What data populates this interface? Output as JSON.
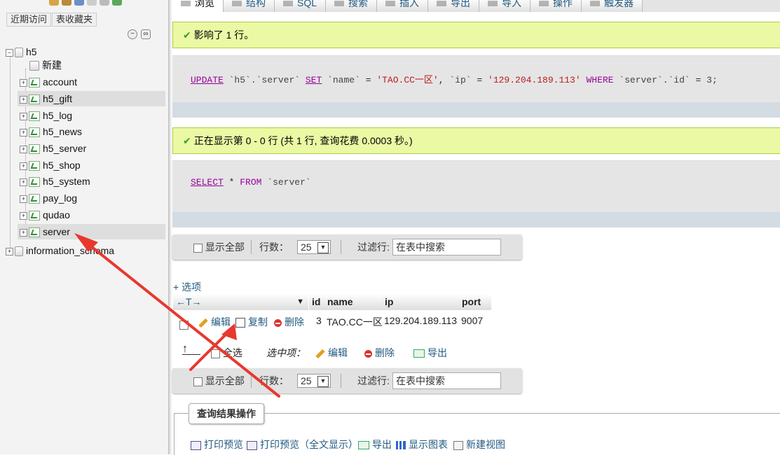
{
  "nav": {
    "tab_recent": "近期访问",
    "tab_favorites": "表收藏夹",
    "db_h5": "h5",
    "new_label": "新建",
    "tables": [
      "account",
      "h5_gift",
      "h5_log",
      "h5_news",
      "h5_server",
      "h5_shop",
      "h5_system",
      "pay_log",
      "qudao",
      "server"
    ],
    "highlighted": [
      "h5_gift",
      "server"
    ],
    "db_info": "information_schema"
  },
  "tabs": [
    "浏览",
    "结构",
    "SQL",
    "搜索",
    "插入",
    "导出",
    "导入",
    "操作",
    "触发器"
  ],
  "messages": {
    "update_msg": "影响了 1 行。",
    "select_msg": "正在显示第 0 - 0 行 (共 1 行, 查询花费 0.0003 秒。)"
  },
  "sql": {
    "update": {
      "kw_update": "UPDATE",
      "table": "`h5`.`server`",
      "kw_set": "SET",
      "col_name": "`name`",
      "eq1": "=",
      "val_name": "'TAO.CC一区'",
      "comma": ",",
      "col_ip": "`ip`",
      "eq2": "=",
      "val_ip": "'129.204.189.113'",
      "kw_where": "WHERE",
      "where_col": "`server`.`id`",
      "eq3": "=",
      "val_id": "3;"
    },
    "select": {
      "kw_select": "SELECT",
      "star": "*",
      "kw_from": "FROM",
      "table": "`server`"
    }
  },
  "navbar": {
    "show_all": "显示全部",
    "rows_label": "行数：",
    "rows_value": "25",
    "filter_label": "过滤行:",
    "filter_placeholder": "在表中搜索"
  },
  "results": {
    "options_link": "+ 选项",
    "sort_arrows": "←T→",
    "columns": [
      "id",
      "name",
      "ip",
      "port"
    ],
    "row": {
      "edit": "编辑",
      "copy": "复制",
      "delete": "删除",
      "id": "3",
      "name": "TAO.CC一区",
      "ip": "129.204.189.113",
      "port": "9007"
    },
    "bulk": {
      "select_all": "全选",
      "with_selected": "选中项：",
      "edit": "编辑",
      "delete": "删除",
      "export": "导出"
    }
  },
  "query_ops": {
    "legend": "查询结果操作",
    "print": "打印预览",
    "print_full": "打印预览（全文显示）",
    "export": "导出",
    "chart": "显示图表",
    "create_view": "新建视图"
  },
  "colors": {
    "success_bg": "#ebf8a4",
    "link": "#235a81",
    "keyword": "#990099",
    "string": "#bb1c1c",
    "annotation_arrow": "#e8382e"
  }
}
